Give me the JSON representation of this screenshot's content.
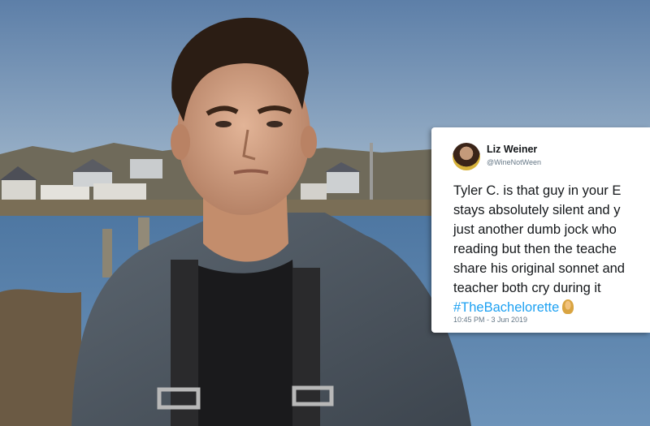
{
  "tweet": {
    "author_name": "Liz Weiner",
    "author_handle": "@WineNotWeen",
    "text_lines": [
      "Tyler C. is that guy in your E",
      "stays absolutely silent and y",
      "just another dumb jock who",
      "reading but then the teache",
      "share his original sonnet and",
      "teacher both cry during it"
    ],
    "hashtag": "#TheBachelorette",
    "timestamp": "10:45 PM - 3 Jun 2019"
  },
  "colors": {
    "hashtag": "#1da1f2",
    "card_background": "#ffffff",
    "sky": "#6b8fb5",
    "water": "#5f86ad"
  },
  "icons": [
    "author-avatar",
    "person-emoji-icon"
  ]
}
